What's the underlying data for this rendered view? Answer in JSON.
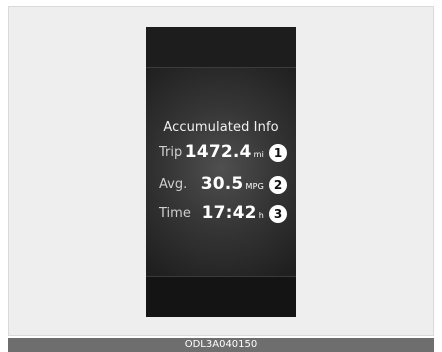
{
  "display": {
    "title": "Accumulated Info",
    "rows": [
      {
        "label": "Trip",
        "value": "1472.4",
        "unit": "mi",
        "marker": "1"
      },
      {
        "label": "Avg.",
        "value": "30.5",
        "unit": "MPG",
        "marker": "2"
      },
      {
        "label": "Time",
        "value": "17:42",
        "unit": "h",
        "marker": "3"
      }
    ]
  },
  "footer": {
    "code": "ODL3A040150"
  },
  "colors": {
    "background": "#eeeeee",
    "cluster": "#171717",
    "text": "#ffffff",
    "footer_bar": "#6e6e6e"
  }
}
